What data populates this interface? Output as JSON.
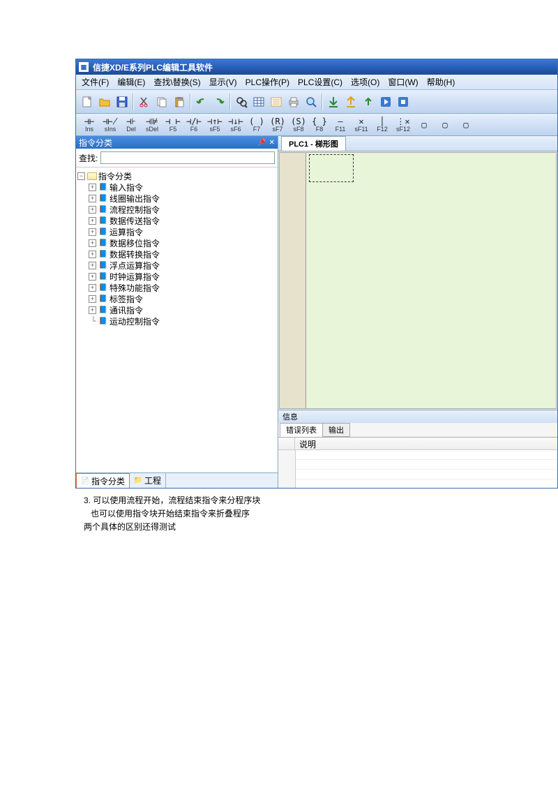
{
  "window": {
    "title": "信捷XD/E系列PLC编辑工具软件"
  },
  "menu": {
    "file": "文件(F)",
    "edit": "编辑(E)",
    "search": "查找\\替换(S)",
    "view": "显示(V)",
    "plcop": "PLC操作(P)",
    "plcset": "PLC设置(C)",
    "options": "选项(O)",
    "window": "窗口(W)",
    "help": "帮助(H)"
  },
  "ladder_symbols": [
    {
      "sym": "⊣⊢",
      "lbl": "Ins"
    },
    {
      "sym": "⊣⊬",
      "lbl": "sIns"
    },
    {
      "sym": "⊣⊦",
      "lbl": "Del"
    },
    {
      "sym": "⊣⊯",
      "lbl": "sDel"
    },
    {
      "sym": "⊣ ⊢",
      "lbl": "F5"
    },
    {
      "sym": "⊣/⊢",
      "lbl": "F6"
    },
    {
      "sym": "⊣↑⊢",
      "lbl": "sF5"
    },
    {
      "sym": "⊣↓⊢",
      "lbl": "sF6"
    },
    {
      "sym": "( )",
      "lbl": "F7"
    },
    {
      "sym": "(R)",
      "lbl": "sF7"
    },
    {
      "sym": "(S)",
      "lbl": "sF8"
    },
    {
      "sym": "{ }",
      "lbl": "F8"
    },
    {
      "sym": "—",
      "lbl": "F11"
    },
    {
      "sym": "✕",
      "lbl": "sF11"
    },
    {
      "sym": "│",
      "lbl": "F12"
    },
    {
      "sym": "⋮✕",
      "lbl": "sF12"
    },
    {
      "sym": "▢",
      "lbl": ""
    },
    {
      "sym": "▢",
      "lbl": ""
    },
    {
      "sym": "▢",
      "lbl": ""
    }
  ],
  "sidebar": {
    "header": "指令分类",
    "search_label": "查找:",
    "search_value": "",
    "root": "指令分类",
    "items": [
      "输入指令",
      "线圈输出指令",
      "流程控制指令",
      "数据传送指令",
      "运算指令",
      "数据移位指令",
      "数据转换指令",
      "浮点运算指令",
      "时钟运算指令",
      "特殊功能指令",
      "标签指令",
      "通讯指令",
      "运动控制指令"
    ],
    "tab_active": "指令分类",
    "tab_project": "工程"
  },
  "doc": {
    "tab_title": "PLC1 - 梯形图"
  },
  "info": {
    "panel_label": "信息",
    "tab_errors": "错误列表",
    "tab_output": "输出",
    "col_desc": "说明"
  },
  "annotations": {
    "line1": "3. 可以使用流程开始，流程结束指令来分程序块",
    "line2": "   也可以使用指令块开始结束指令来折叠程序",
    "line3": "两个具体的区别还得测试"
  }
}
